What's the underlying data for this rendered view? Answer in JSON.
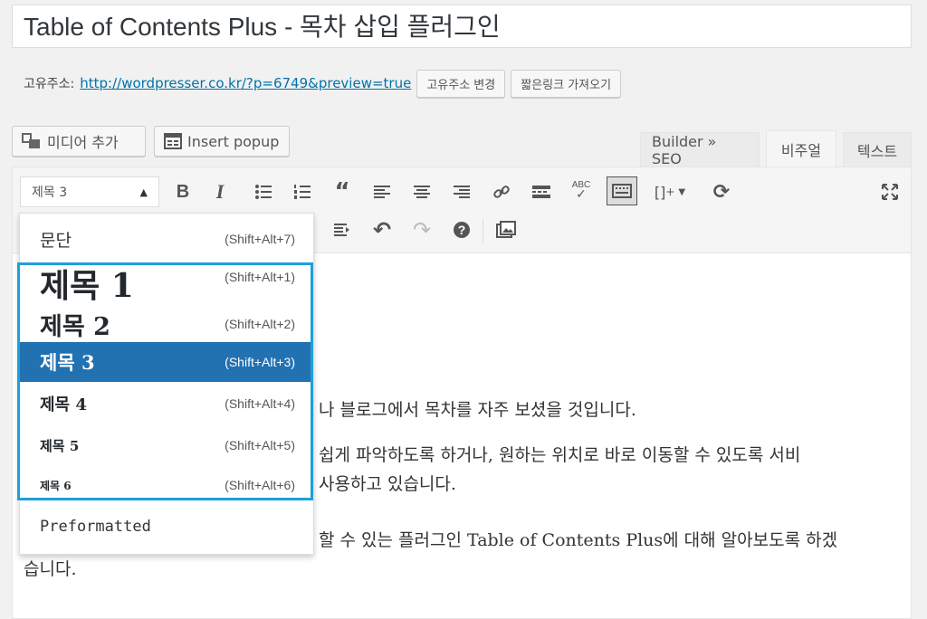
{
  "post": {
    "title": "Table of Contents Plus - 목차 삽입 플러그인"
  },
  "permalink": {
    "label": "고유주소:",
    "url": "http://wordpresser.co.kr/?p=6749&preview=true",
    "change_button": "고유주소 변경",
    "shortlink_button": "짧은링크 가져오기"
  },
  "media_buttons": {
    "add_media": "미디어 추가",
    "insert_popup": "Insert popup"
  },
  "editor_tabs": {
    "builder_seo": "Builder » SEO",
    "visual": "비주얼",
    "text": "텍스트"
  },
  "toolbar": {
    "format_select": "제목 3"
  },
  "format_menu": {
    "items": [
      {
        "label": "문단",
        "shortcut": "(Shift+Alt+7)"
      },
      {
        "label": "제목 1",
        "shortcut": "(Shift+Alt+1)"
      },
      {
        "label": "제목 2",
        "shortcut": "(Shift+Alt+2)"
      },
      {
        "label": "제목 3",
        "shortcut": "(Shift+Alt+3)"
      },
      {
        "label": "제목 4",
        "shortcut": "(Shift+Alt+4)"
      },
      {
        "label": "제목 5",
        "shortcut": "(Shift+Alt+5)"
      },
      {
        "label": "제목 6",
        "shortcut": "(Shift+Alt+6)"
      },
      {
        "label": "Preformatted",
        "shortcut": ""
      }
    ]
  },
  "content": {
    "line1": "나 블로그에서 목차를 자주 보셨을 것입니다.",
    "line2": "쉽게 파악하도록 하거나, 원하는 위치로 바로 이동할 수 있도록 서비",
    "line3": "사용하고 있습니다.",
    "line4": "할 수 있는 플러그인 Table of Contents Plus에 대해 알아보도록 하겠",
    "line5": "습니다."
  },
  "colors": {
    "highlight_border": "#1fa0d8",
    "selected_item_bg": "#2271b1"
  }
}
